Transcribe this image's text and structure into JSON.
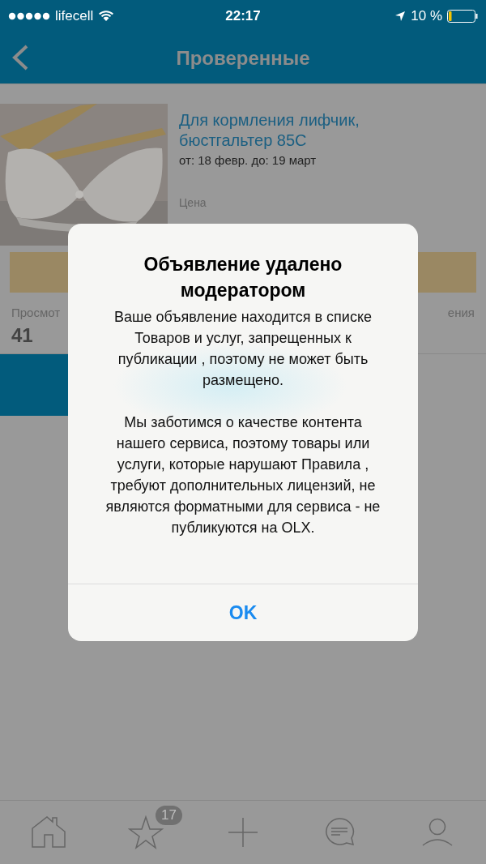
{
  "status_bar": {
    "carrier": "lifecell",
    "time": "22:17",
    "battery": "10 %"
  },
  "nav_bar": {
    "title": "Проверенные"
  },
  "listing": {
    "title": "Для кормления лифчик, бюстгальтер 85С",
    "dates": "от: 18 февр. до: 19 март",
    "price_label": "Цена",
    "stats": [
      {
        "label": "Просмот",
        "value": "41"
      },
      {
        "label": "ения"
      }
    ]
  },
  "alert": {
    "title": "Объявление удалено модератором",
    "paragraphs": [
      "Ваше объявление находится в списке  Товаров и услуг, запрещенных к публикации , поэтому не может быть размещено.",
      "Мы заботимся о качестве контента нашего сервиса, поэтому товары или услуги, которые нарушают Правила , требуют дополнительных лицензий, не являются форматными для сервиса - не публикуются на OLX."
    ],
    "buttons": [
      "OK"
    ]
  },
  "tab_bar": {
    "items": [
      {
        "kind": "home"
      },
      {
        "kind": "star",
        "badge": "17"
      },
      {
        "kind": "plus"
      },
      {
        "kind": "chat"
      },
      {
        "kind": "profile"
      }
    ]
  }
}
